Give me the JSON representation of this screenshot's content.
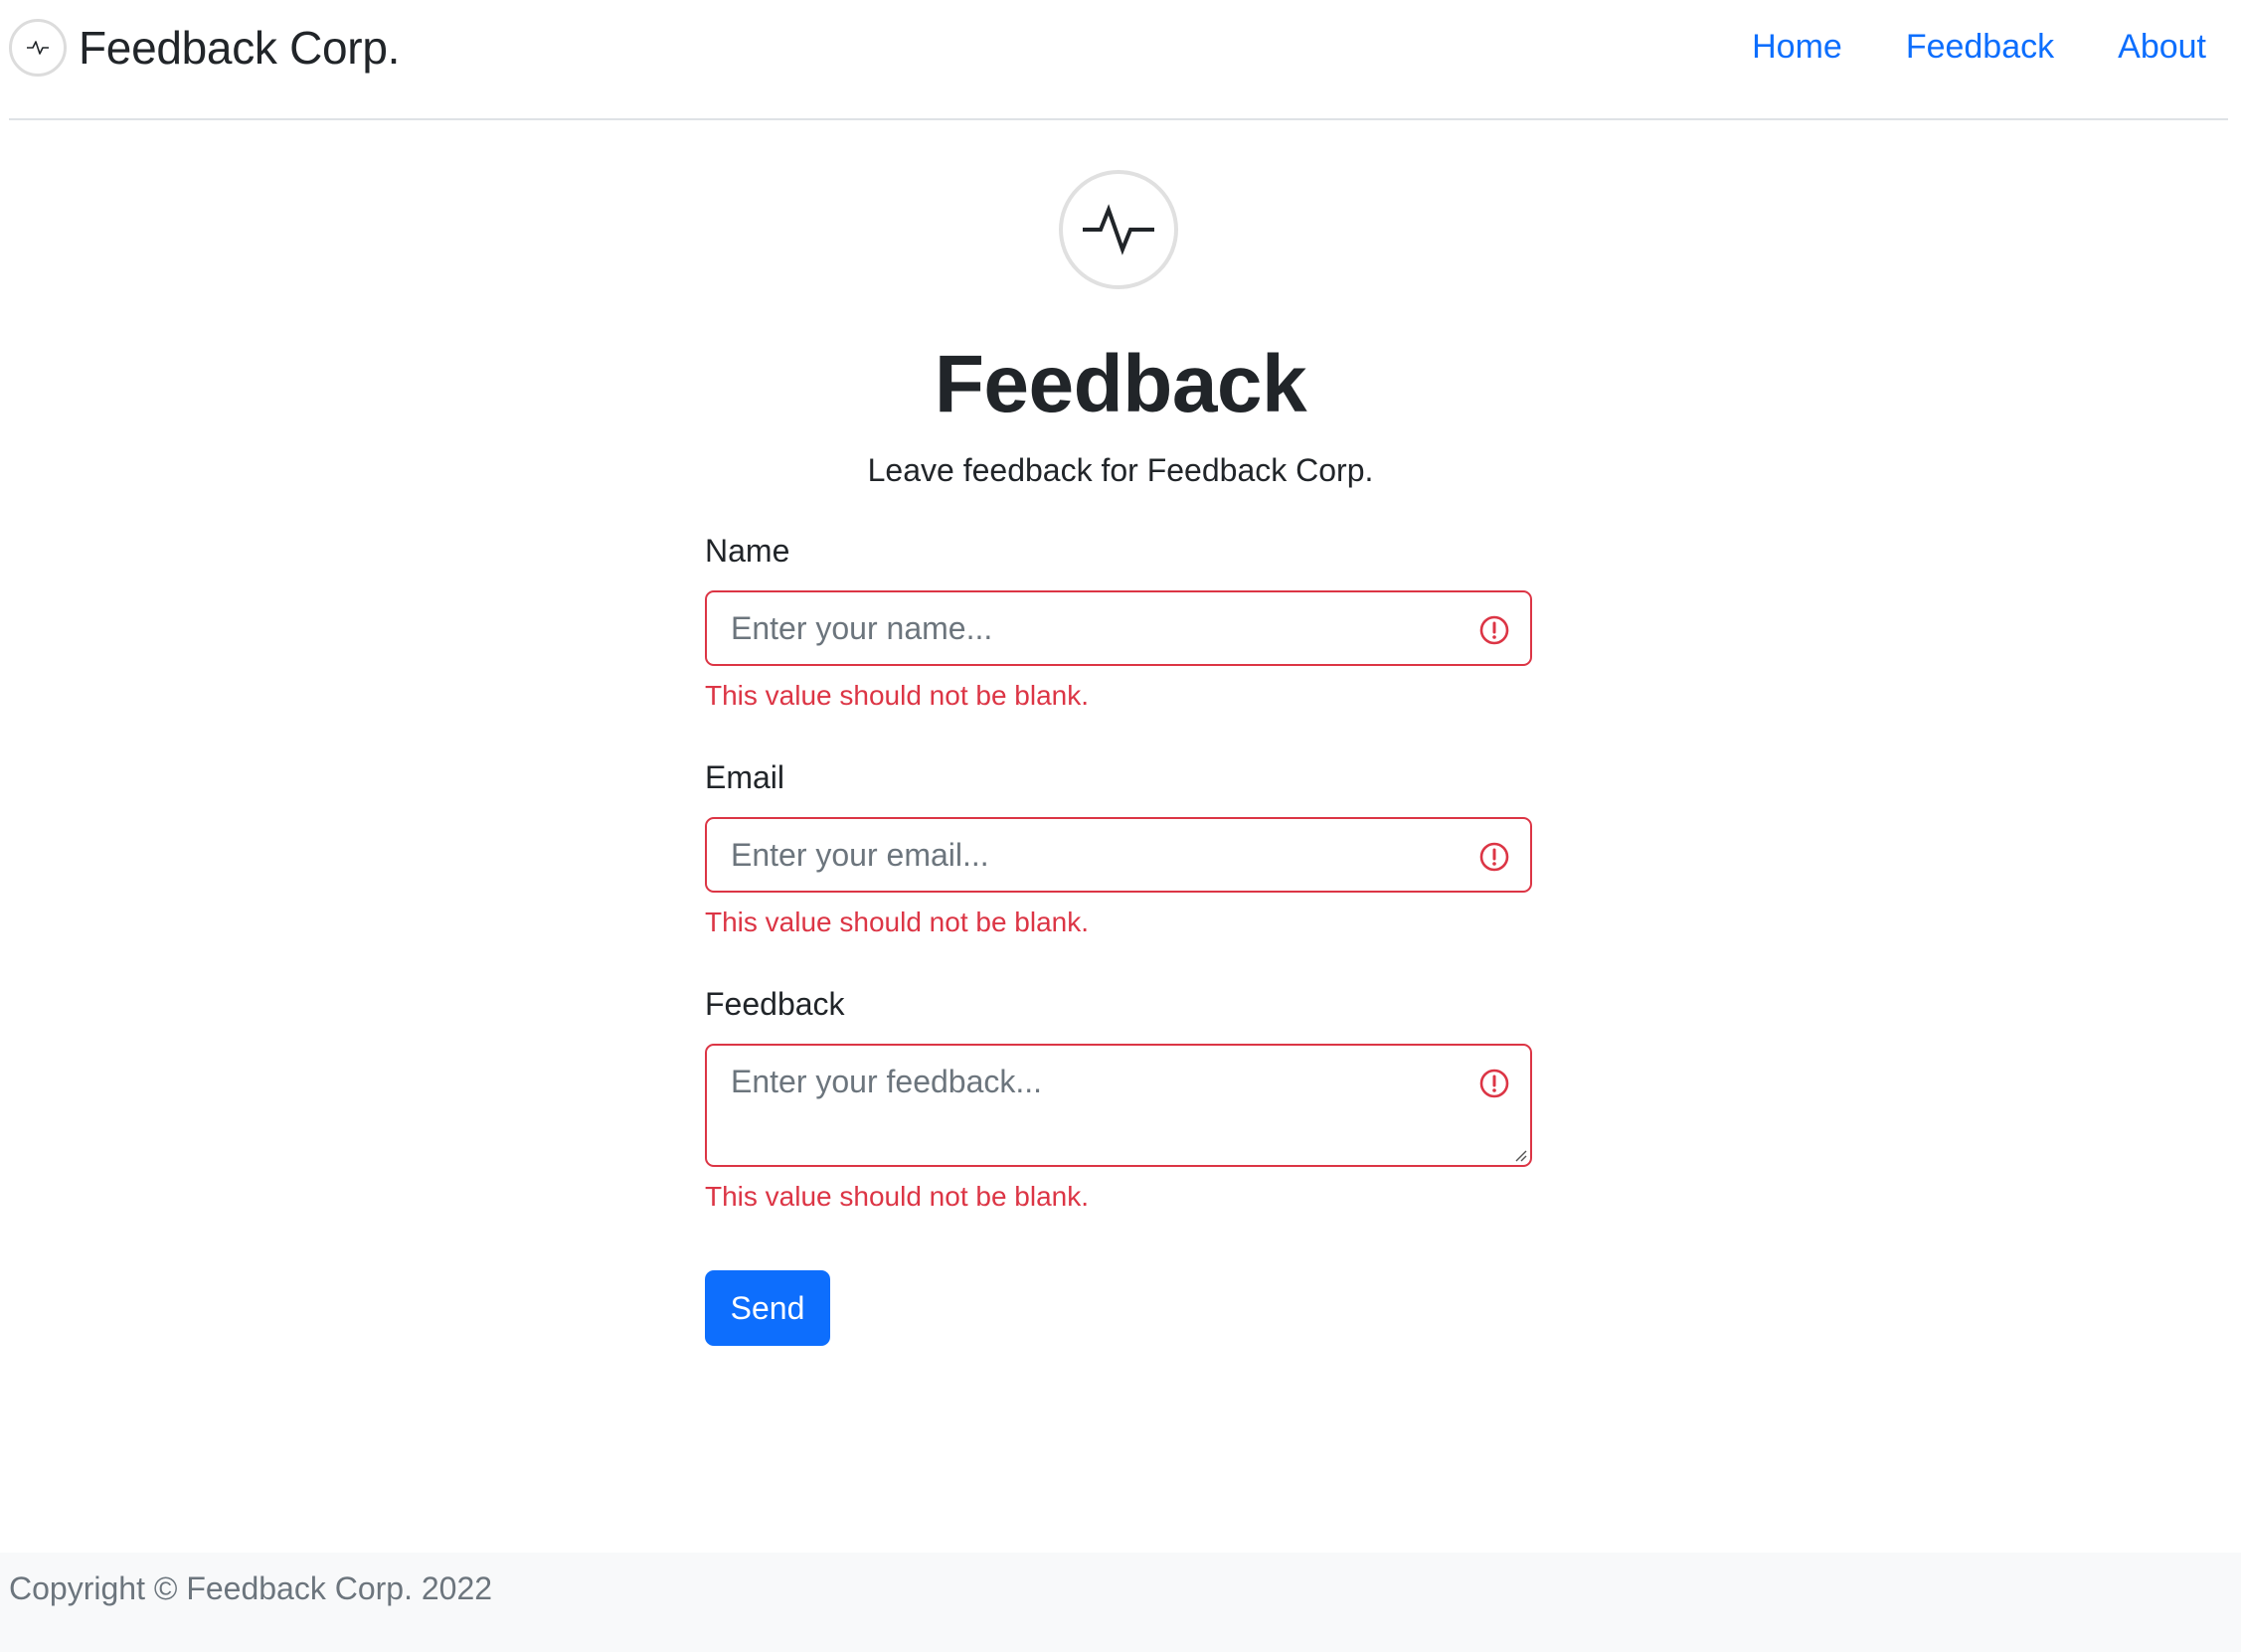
{
  "brand": {
    "name": "Feedback Corp.",
    "logo_icon": "pulse-icon"
  },
  "nav": {
    "items": [
      "Home",
      "Feedback",
      "About"
    ]
  },
  "hero": {
    "logo_icon": "pulse-icon",
    "title": "Feedback",
    "subtitle": "Leave feedback for Feedback Corp."
  },
  "form": {
    "name": {
      "label": "Name",
      "value": "",
      "placeholder": "Enter your name...",
      "error": "This value should not be blank."
    },
    "email": {
      "label": "Email",
      "value": "",
      "placeholder": "Enter your email...",
      "error": "This value should not be blank."
    },
    "feedback": {
      "label": "Feedback",
      "value": "",
      "placeholder": "Enter your feedback...",
      "error": "This value should not be blank."
    },
    "submit_label": "Send"
  },
  "footer": {
    "copyright": "Copyright © Feedback Corp. 2022"
  },
  "colors": {
    "primary": "#0d6efd",
    "danger": "#dc3545",
    "muted": "#6c757d",
    "footer_bg": "#f8f9fa"
  }
}
